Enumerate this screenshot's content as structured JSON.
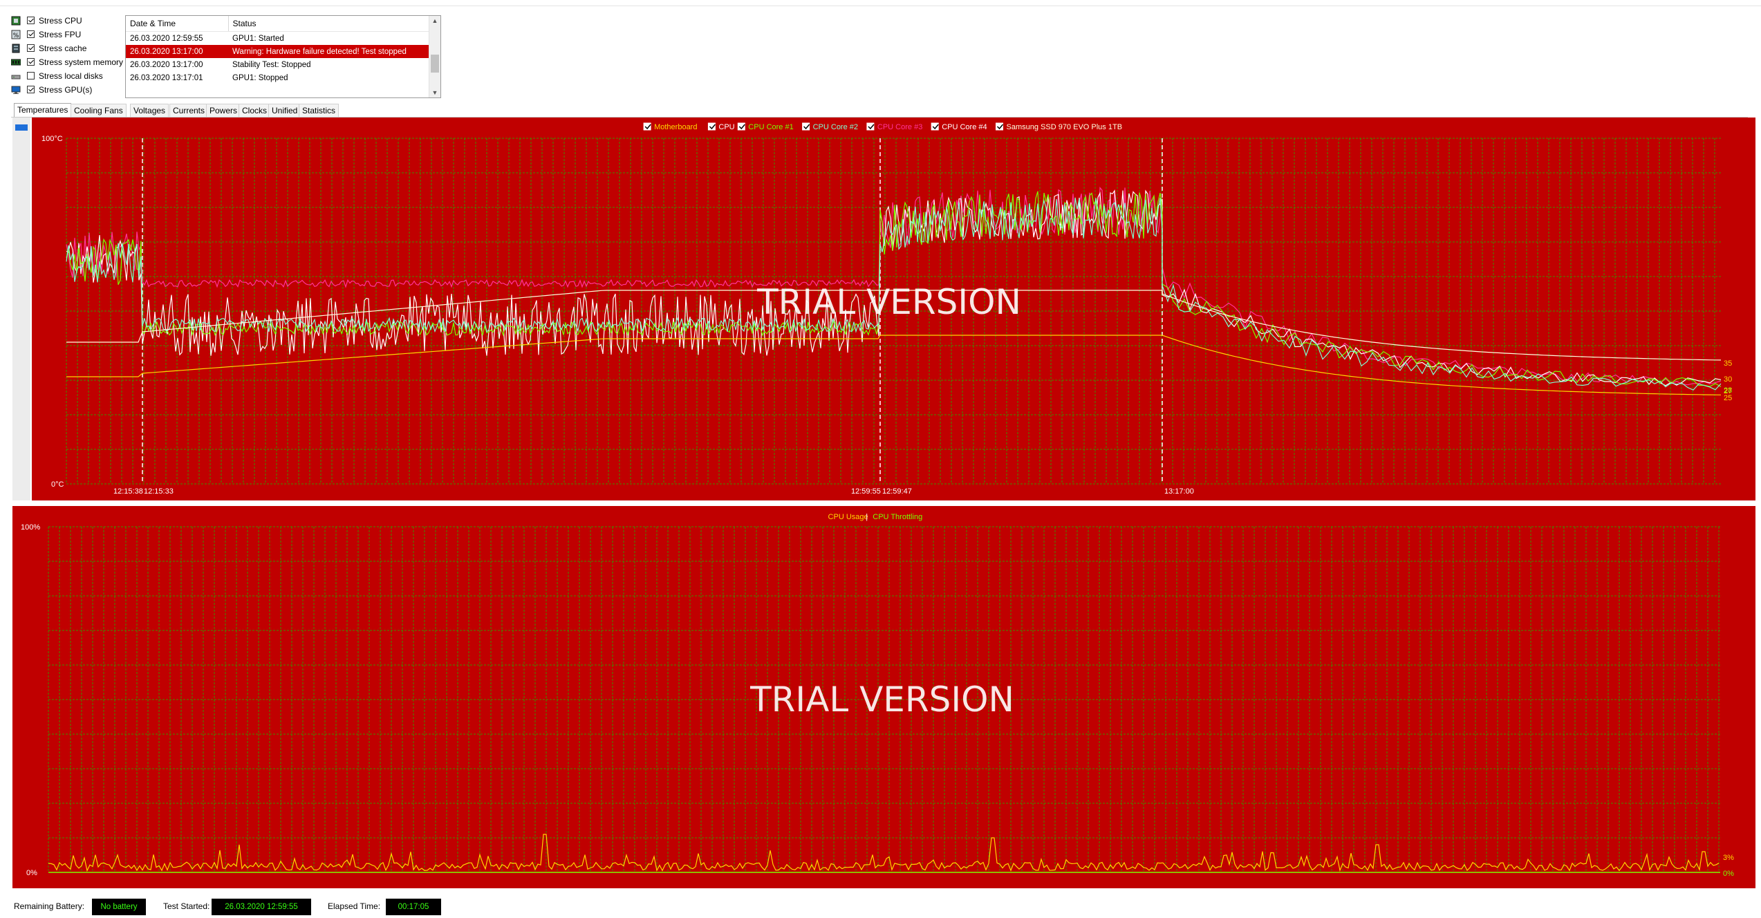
{
  "stress_options": [
    {
      "label": "Stress CPU",
      "checked": true,
      "icon": "cpu-chip-icon"
    },
    {
      "label": "Stress FPU",
      "checked": true,
      "icon": "fpu-icon"
    },
    {
      "label": "Stress cache",
      "checked": true,
      "icon": "cache-icon"
    },
    {
      "label": "Stress system memory",
      "checked": true,
      "icon": "memory-module-icon"
    },
    {
      "label": "Stress local disks",
      "checked": false,
      "icon": "disk-drive-icon"
    },
    {
      "label": "Stress GPU(s)",
      "checked": true,
      "icon": "monitor-icon"
    }
  ],
  "log": {
    "columns": [
      "Date & Time",
      "Status"
    ],
    "rows": [
      {
        "time": "26.03.2020 12:59:55",
        "status": "GPU1: Started",
        "selected": false
      },
      {
        "time": "26.03.2020 13:17:00",
        "status": "Warning: Hardware failure detected! Test stopped",
        "selected": true
      },
      {
        "time": "26.03.2020 13:17:00",
        "status": "Stability Test: Stopped",
        "selected": false
      },
      {
        "time": "26.03.2020 13:17:01",
        "status": "GPU1: Stopped",
        "selected": false
      }
    ]
  },
  "tabs": [
    "Temperatures",
    "Cooling Fans",
    "Voltages",
    "Currents",
    "Powers",
    "Clocks",
    "Unified",
    "Statistics"
  ],
  "active_tab": "Temperatures",
  "colors": {
    "chart_background": "#c00000",
    "grid": "#3f8f00",
    "motherboard": "#ffd700",
    "cpu": "#ffffff",
    "core1": "#7cfc00",
    "core2": "#7fffd4",
    "core3": "#ff3399",
    "core4": "#ffffff",
    "ssd": "#ffffe0",
    "cpu_usage": "#ffd700",
    "cpu_throttling": "#7cfc00",
    "status_text": "#39ff14"
  },
  "chart_data": [
    {
      "type": "line",
      "watermark": "TRIAL VERSION",
      "y_max_label": "100°C",
      "y_min_label": "0°C",
      "ylim": [
        0,
        100
      ],
      "legend_position": "top",
      "legend": [
        {
          "name": "Motherboard",
          "color": "#ffd700"
        },
        {
          "name": "CPU",
          "color": "#ffffff"
        },
        {
          "name": "CPU Core #1",
          "color": "#7cfc00"
        },
        {
          "name": "CPU Core #2",
          "color": "#7fffd4"
        },
        {
          "name": "CPU Core #3",
          "color": "#ff3399"
        },
        {
          "name": "CPU Core #4",
          "color": "#ffffff"
        },
        {
          "name": "Samsung SSD 970 EVO Plus 1TB",
          "color": "#ffffe0"
        }
      ],
      "time_markers": [
        "12:15:38",
        "12:15:33",
        "12:59:55",
        "12:59:47",
        "13:17:00"
      ],
      "end_labels": [
        {
          "text": "35",
          "value": 35,
          "color": "#ffd700"
        },
        {
          "text": "30",
          "value": 30,
          "color": "#ffd700"
        },
        {
          "text": "28",
          "value": 28,
          "color": "#7cfc00"
        },
        {
          "text": "27",
          "value": 27,
          "color": "#ffd700"
        },
        {
          "text": "25",
          "value": 25,
          "color": "#ffd700"
        }
      ],
      "series_shape": [
        {
          "name": "CPU Core #3",
          "phases": [
            {
              "value": 66,
              "noise": 7
            },
            {
              "value": 58,
              "noise": 1
            },
            {
              "value": 79,
              "noise": 7
            },
            {
              "start": 60,
              "end": 28
            }
          ]
        },
        {
          "name": "CPU",
          "phases": [
            {
              "value": 65,
              "noise": 7
            },
            {
              "value": 46,
              "noise": 9
            },
            {
              "value": 78,
              "noise": 7
            },
            {
              "start": 58,
              "end": 28
            }
          ]
        },
        {
          "name": "CPU Core #1",
          "phases": [
            {
              "value": 64,
              "noise": 7
            },
            {
              "value": 45,
              "noise": 2
            },
            {
              "value": 78,
              "noise": 7
            },
            {
              "start": 57,
              "end": 28
            }
          ]
        },
        {
          "name": "CPU Core #2",
          "phases": [
            {
              "value": 64,
              "noise": 6
            },
            {
              "value": 46,
              "noise": 2
            },
            {
              "value": 77,
              "noise": 6
            },
            {
              "start": 56,
              "end": 27
            }
          ]
        },
        {
          "name": "Samsung SSD 970 EVO Plus 1TB",
          "phases": [
            {
              "value": 41
            },
            {
              "start": 44,
              "end": 56
            },
            {
              "value": 56
            },
            {
              "start": 55,
              "end": 35
            }
          ]
        },
        {
          "name": "Motherboard",
          "phases": [
            {
              "value": 31
            },
            {
              "start": 32,
              "end": 42
            },
            {
              "value": 43
            },
            {
              "start": 43,
              "end": 25
            }
          ]
        }
      ]
    },
    {
      "type": "line",
      "watermark": "TRIAL VERSION",
      "y_max_label": "100%",
      "y_min_label": "0%",
      "ylim": [
        0,
        100
      ],
      "legend_position": "top",
      "legend": [
        {
          "name": "CPU Usage",
          "color": "#ffd700"
        },
        {
          "name": "CPU Throttling",
          "color": "#7cfc00"
        }
      ],
      "legend_separator": "|",
      "end_labels": [
        {
          "text": "3%",
          "value": 3,
          "color": "#ffd700"
        },
        {
          "text": "0%",
          "value": 0,
          "color": "#7cfc00"
        }
      ],
      "series_shape": [
        {
          "name": "CPU Usage",
          "baseline": 2,
          "spikes": [
            {
              "at": 0.114,
              "value": 8
            },
            {
              "at": 0.297,
              "value": 11
            },
            {
              "at": 0.565,
              "value": 10
            },
            {
              "at": 0.795,
              "value": 8
            },
            {
              "at": 0.99,
              "value": 6
            }
          ]
        },
        {
          "name": "CPU Throttling",
          "value": 0
        }
      ]
    }
  ],
  "status_bar": {
    "battery_label": "Remaining Battery:",
    "battery_value": "No battery",
    "started_label": "Test Started:",
    "started_value": "26.03.2020 12:59:55",
    "elapsed_label": "Elapsed Time:",
    "elapsed_value": "00:17:05"
  }
}
